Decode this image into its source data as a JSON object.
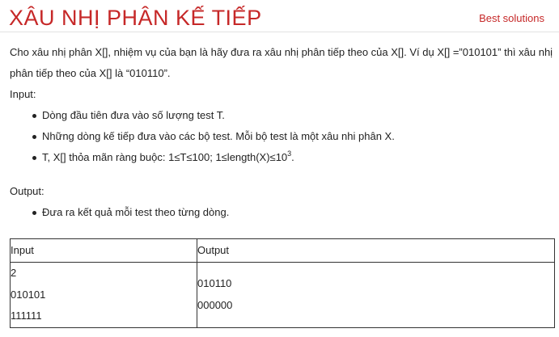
{
  "header": {
    "title": "XÂU NHỊ PHÂN KẾ TIẾP",
    "link": "Best solutions"
  },
  "intro": {
    "line1": "Cho xâu nhị phân X[], nhiệm vụ của bạn là hãy đưa ra xâu nhị phân tiếp theo của X[]. Ví dụ X[] =”010101” thì xâu nhị",
    "line2": "phân tiếp theo của X[] là “010110”."
  },
  "input_section": {
    "label": "Input:",
    "items": [
      "Dòng đầu tiên đưa vào số lượng test T.",
      "Những dòng kế tiếp đưa vào các bộ test. Mỗi bộ test là một xâu nhi phân X."
    ],
    "constraint_prefix": "T, X[] thỏa mãn ràng buộc: 1≤T≤100; 1≤length(X)≤10",
    "constraint_sup": "3",
    "constraint_suffix": "."
  },
  "output_section": {
    "label": "Output:",
    "items": [
      "Đưa ra kết quả mỗi test theo từng dòng."
    ]
  },
  "example_table": {
    "headers": [
      "Input",
      "Output"
    ],
    "input_lines": [
      "2",
      "010101",
      "111111"
    ],
    "output_lines": [
      "010110",
      "000000"
    ]
  }
}
